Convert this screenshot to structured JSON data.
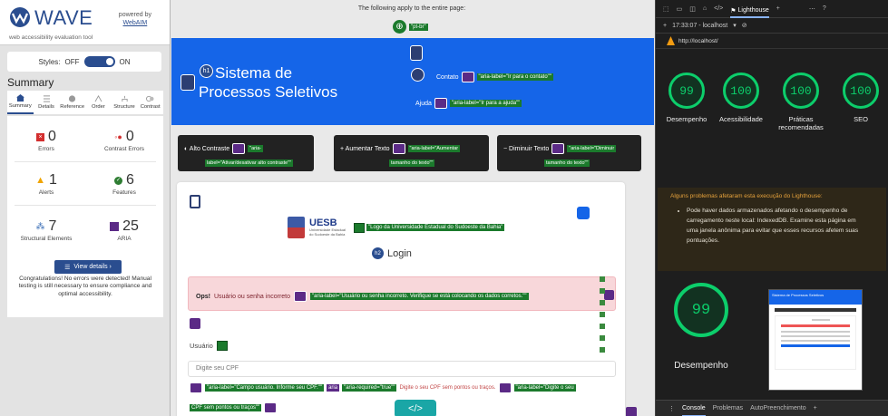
{
  "wave": {
    "logo_text": "WAVE",
    "logo_sub": "web accessibility evaluation tool",
    "powered_by": "powered by",
    "powered_link": "WebAIM",
    "styles_label": "Styles:",
    "styles_off": "OFF",
    "styles_on": "ON",
    "summary_title": "Summary",
    "tabs": [
      {
        "label": "Summary",
        "icon": "home-icon"
      },
      {
        "label": "Details",
        "icon": "list-icon"
      },
      {
        "label": "Reference",
        "icon": "info-icon"
      },
      {
        "label": "Order",
        "icon": "order-icon"
      },
      {
        "label": "Structure",
        "icon": "structure-icon"
      },
      {
        "label": "Contrast",
        "icon": "contrast-icon"
      }
    ],
    "stats": {
      "errors": {
        "value": "0",
        "label": "Errors"
      },
      "contrast": {
        "value": "0",
        "label": "Contrast Errors"
      },
      "alerts": {
        "value": "1",
        "label": "Alerts"
      },
      "features": {
        "value": "6",
        "label": "Features"
      },
      "structural": {
        "value": "7",
        "label": "Structural Elements"
      },
      "aria": {
        "value": "25",
        "label": "ARIA"
      }
    },
    "view_details": "View details ›",
    "congrats": "Congratulations! No errors were detected! Manual testing is still necessary to ensure compliance and optimal accessibility.",
    "colors": {
      "brand": "#2a4d8f",
      "error": "#d32f2f",
      "alert": "#f0a400",
      "feature": "#2e7d32",
      "aria": "#5b2a86"
    }
  },
  "page": {
    "top_note": "The following apply to the entire page:",
    "lang_tag": "\"pt-br\"",
    "hero_title": "Sistema de Processos Seletivos",
    "h1_badge": "h1",
    "contato_label": "Contato",
    "contato_aria": "\"aria-label=\"Ir para o contato\"\"",
    "ajuda_label": "Ajuda",
    "ajuda_aria": "\"aria-label=\"Ir para a ajuda\"\"",
    "controls": [
      {
        "label": "◐ Alto Contraste",
        "aria_a": "\"aria-",
        "aria_b": "label=\"Ativar/desativar alto contraste\"\""
      },
      {
        "label": "+ Aumentar Texto",
        "aria_a": "\"aria-label=\"Aumentar",
        "aria_b": "tamanho do texto\"\""
      },
      {
        "label": "− Diminuir Texto",
        "aria_a": "\"aria-label=\"Diminuir",
        "aria_b": "tamanho do texto\"\""
      }
    ],
    "uesb_name": "UESB",
    "uesb_sub": "Universidade Estadual do Sudoeste da Bahia",
    "uesb_alt": "\"Logo da Universidade Estadual do Sudoeste da Bahia\"",
    "login_title": "Login",
    "h2_badge": "h2",
    "alert_bold": "Ops!",
    "alert_text": "Usuário ou senha incorreto",
    "alert_aria": "\"aria-label=\"Usuário ou senha incorreto. Verifique se está colocando os dados corretos.\"\"",
    "user_label": "Usuário",
    "user_placeholder": "Digite seu CPF",
    "err_aria1": "\"aria-label=\"Campo usuário. Informe seu CPF.\"\"",
    "err_aria_tag": "aria",
    "err_aria2": "\"aria-required=\"true\"\"",
    "err_text": "Digite o seu CPF sem pontos ou traços.",
    "err_aria3": "\"aria-label=\"Digite o seu",
    "err_aria3b": "CPF sem pontos ou traços\"\"",
    "code_btn": "</>",
    "colors": {
      "hero": "#1565e8",
      "wave_green": "#1b7a2c",
      "wave_purple": "#5b2a86",
      "alert_bg": "#f8d7da"
    }
  },
  "devtools": {
    "tab_lighthouse": "Lighthouse",
    "time_host": "17:33:07 - localhost",
    "url": "http://localhost/",
    "scores": [
      {
        "value": "99",
        "label": "Desempenho"
      },
      {
        "value": "100",
        "label": "Acessibilidade"
      },
      {
        "value": "100",
        "label": "Práticas recomendadas"
      },
      {
        "value": "100",
        "label": "SEO"
      }
    ],
    "warn_title": "Alguns problemas afetaram esta execução do Lighthouse:",
    "warn_item": "Pode haver dados armazenados afetando o desempenho de carregamento neste local: IndexedDB. Examine esta página em uma janela anônima para evitar que esses recursos afetem suas pontuações.",
    "big_score": "99",
    "big_label": "Desempenho",
    "thumb_title": "Sistema de Processos Seletivos",
    "console_tabs": [
      "Console",
      "Problemas",
      "AutoPreenchimento"
    ],
    "colors": {
      "pass": "#0cce6b",
      "warn": "#e6a23c"
    }
  }
}
